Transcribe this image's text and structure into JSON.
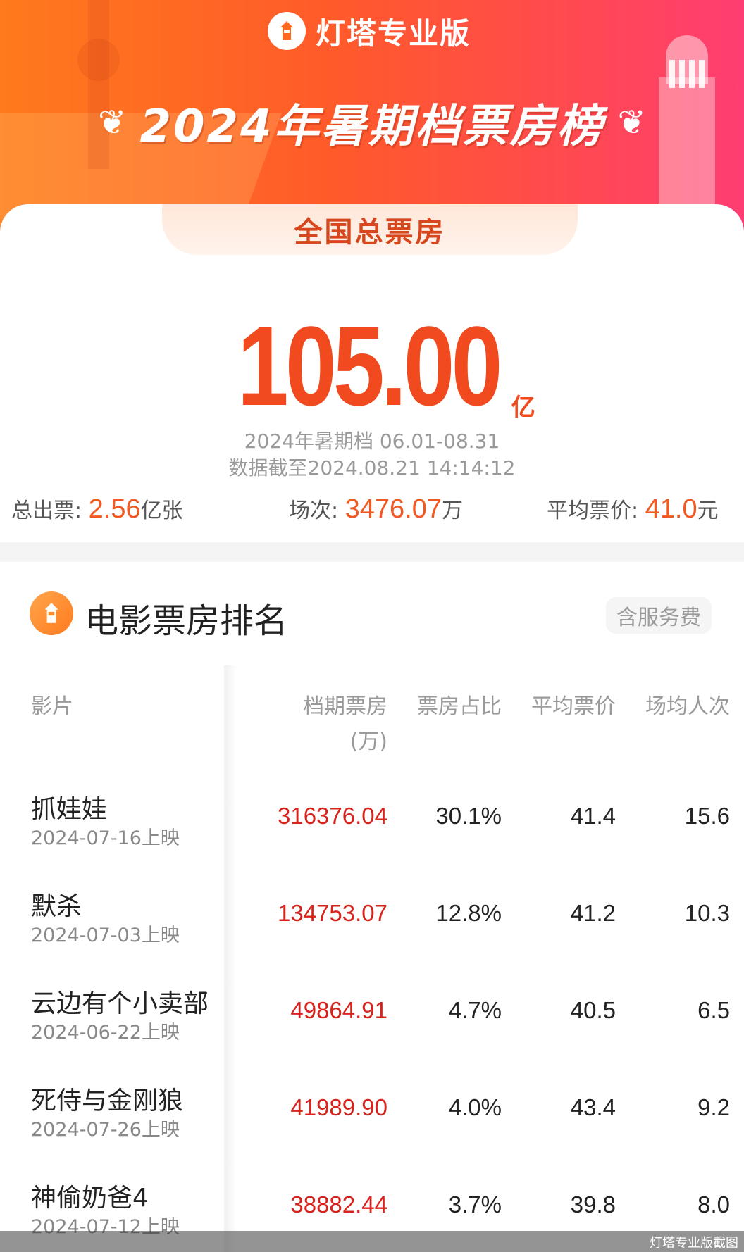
{
  "brand": {
    "name": "灯塔专业版"
  },
  "title": "2024年暑期档票房榜",
  "tab_label": "全国总票房",
  "total": {
    "value": "105.00",
    "unit": "亿",
    "period": "2024年暑期档 06.01-08.31",
    "as_of": "数据截至2024.08.21 14:14:12"
  },
  "stats": {
    "tickets": {
      "label": "总出票:",
      "value": "2.56",
      "unit": "亿张"
    },
    "screenings": {
      "label": "场次:",
      "value": "3476.07",
      "unit": "万"
    },
    "avg_price": {
      "label": "平均票价:",
      "value": "41.0",
      "unit": "元"
    }
  },
  "section": {
    "title": "电影票房排名",
    "fee_badge": "含服务费"
  },
  "columns": {
    "film": "影片",
    "box": "档期票房",
    "box_unit": "(万)",
    "share": "票房占比",
    "avg_price": "平均票价",
    "avg_audience": "场均人次"
  },
  "movies": [
    {
      "name": "抓娃娃",
      "date": "2024-07-16上映",
      "box": "316376.04",
      "share": "30.1%",
      "avg_price": "41.4",
      "avg_audience": "15.6"
    },
    {
      "name": "默杀",
      "date": "2024-07-03上映",
      "box": "134753.07",
      "share": "12.8%",
      "avg_price": "41.2",
      "avg_audience": "10.3"
    },
    {
      "name": "云边有个小卖部",
      "date": "2024-06-22上映",
      "box": "49864.91",
      "share": "4.7%",
      "avg_price": "40.5",
      "avg_audience": "6.5"
    },
    {
      "name": "死侍与金刚狼",
      "date": "2024-07-26上映",
      "box": "41989.90",
      "share": "4.0%",
      "avg_price": "43.4",
      "avg_audience": "9.2"
    },
    {
      "name": "神偷奶爸4",
      "date": "2024-07-12上映",
      "box": "38882.44",
      "share": "3.7%",
      "avg_price": "39.8",
      "avg_audience": "8.0"
    }
  ],
  "watermark": "灯塔专业版截图",
  "colors": {
    "accent": "#f04a1e",
    "box_value": "#d8231c",
    "header_start": "#ff7a1c",
    "header_end": "#ff3d72"
  }
}
